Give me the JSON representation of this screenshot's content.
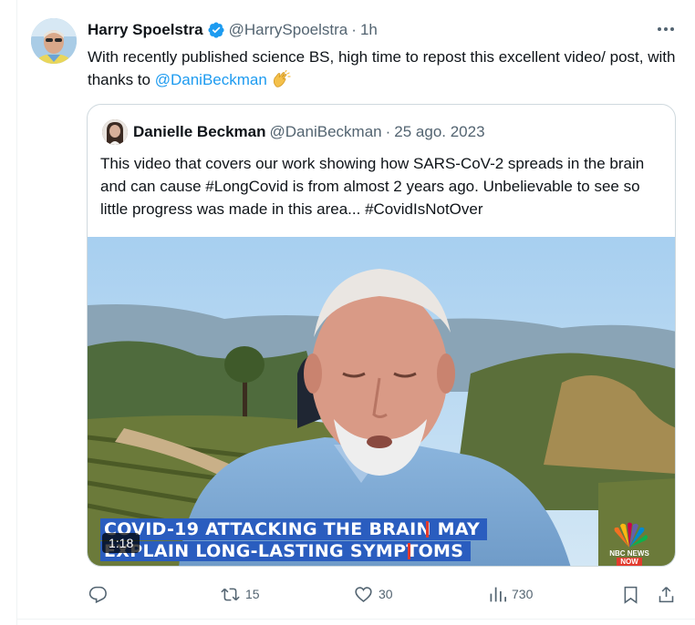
{
  "post": {
    "author_name": "Harry Spoelstra",
    "author_handle": "@HarrySpoelstra",
    "separator": "·",
    "time": "1h",
    "text_main": "With recently published science BS, high time to repost this excellent video/ post, with thanks to ",
    "text_mention": "@DaniBeckman",
    "emoji": "clapping-hands"
  },
  "quote": {
    "author_name": "Danielle Beckman",
    "author_handle": "@DaniBeckman",
    "separator": "·",
    "date": "25 ago. 2023",
    "text": "This video that covers our work showing how SARS-CoV-2 spreads in the brain and can cause #LongCovid is from almost 2 years ago. Unbelievable to see so little progress was made in this area... #CovidIsNotOver",
    "video": {
      "banner_line1": "COVID-19 ATTACKING THE BRAIN MAY",
      "banner_line2": "EXPLAIN LONG-LASTING SYMPTOMS",
      "duration": "1:18",
      "network_logo_text1": "NBC NEWS",
      "network_logo_text2": "NOW"
    }
  },
  "actions": {
    "reply_count": "",
    "repost_count": "15",
    "like_count": "30",
    "views_count": "730"
  },
  "colors": {
    "accent": "#1d9bf0",
    "muted": "#536471",
    "banner": "#2a5dbf",
    "banner_bar": "#e23b2e"
  }
}
